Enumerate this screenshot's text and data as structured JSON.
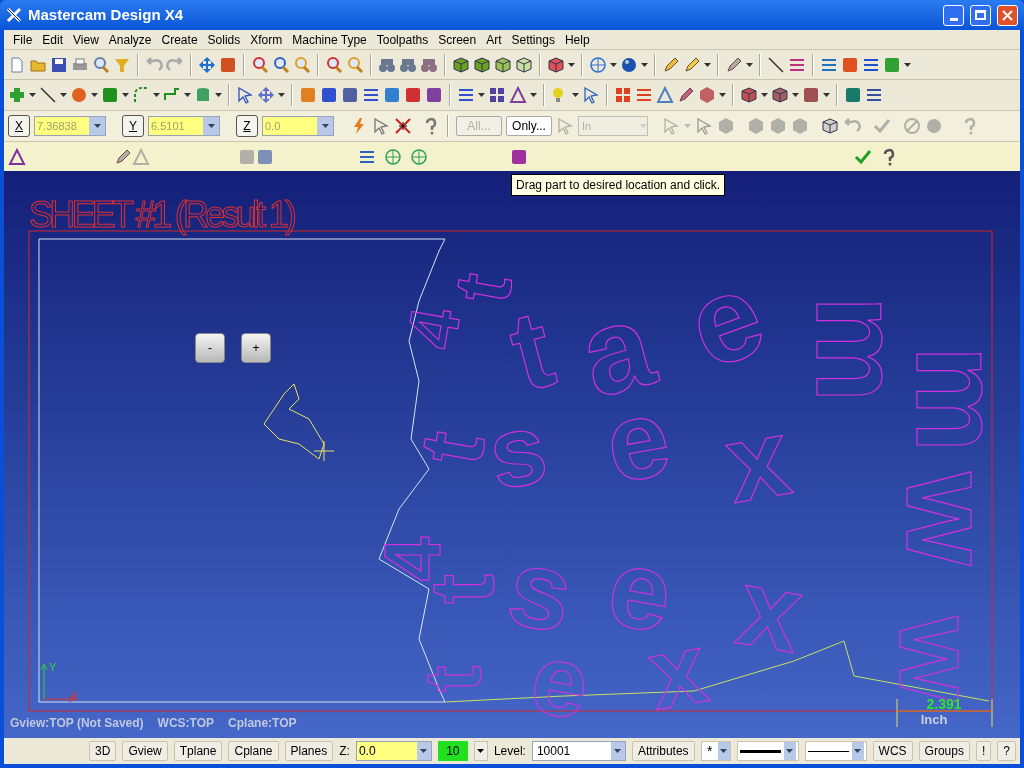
{
  "window": {
    "title": "Mastercam Design X4"
  },
  "menu": [
    "File",
    "Edit",
    "View",
    "Analyze",
    "Create",
    "Solids",
    "Xform",
    "Machine Type",
    "Toolpaths",
    "Screen",
    "Art",
    "Settings",
    "Help"
  ],
  "coordinates": [
    {
      "axis": "X",
      "value": "7.36838"
    },
    {
      "axis": "Y",
      "value": "6.5101"
    },
    {
      "axis": "Z",
      "value": "0.0"
    }
  ],
  "selection_bar": {
    "all_button": {
      "label": "All...",
      "disabled": true
    },
    "only_button": {
      "label": "Only...",
      "disabled": false
    },
    "mode": {
      "value": "In",
      "disabled": true
    }
  },
  "tooltip": "Drag part to desired location and click.",
  "canvas": {
    "sheet_title": "SHEET #1 (Result 1)",
    "zoom_buttons": [
      "-",
      "+"
    ],
    "parts": [
      "4",
      "t",
      "t",
      "a",
      "e",
      "m",
      "m",
      "t",
      "s",
      "e",
      "x",
      "w",
      "4",
      "t",
      "s",
      "e",
      "x",
      "w",
      "t",
      "e",
      "x"
    ],
    "axis_labels": {
      "y": "Y",
      "x": "X"
    },
    "dimension": "2.391",
    "units": "Inch",
    "view_info": [
      "Gview:TOP (Not Saved)",
      "WCS:TOP",
      "Cplane:TOP"
    ]
  },
  "status_bar": {
    "view_buttons": [
      "3D",
      "Gview",
      "Tplane",
      "Cplane",
      "Planes"
    ],
    "z_label": "Z:",
    "z_value": "0.0",
    "color_value": "10",
    "level_label": "Level:",
    "level_value": "10001",
    "attributes_button": "Attributes",
    "point_style": "*",
    "right_buttons": [
      "WCS",
      "Groups",
      "!",
      "?"
    ]
  }
}
